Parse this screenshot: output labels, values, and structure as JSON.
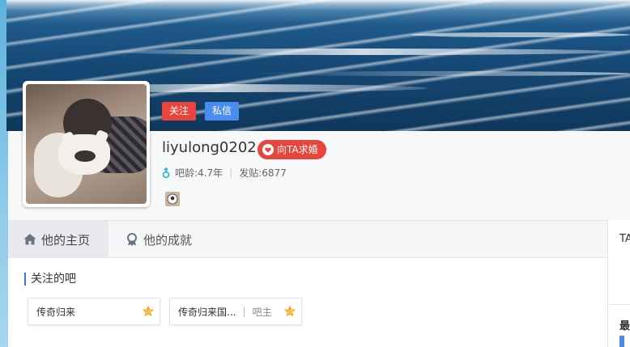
{
  "profile": {
    "username": "liyulong0202",
    "follow_label": "关注",
    "message_label": "私信",
    "propose_label": "向TA求婚",
    "bar_age_label": "吧龄:4.7年",
    "posts_label": "发贴:6877"
  },
  "tabs": [
    {
      "label": "他的主页",
      "icon": "home-icon"
    },
    {
      "label": "他的成就",
      "icon": "badge-icon"
    }
  ],
  "followed_bars": {
    "title": "关注的吧",
    "items": [
      {
        "name": "传奇归来",
        "role": ""
      },
      {
        "name": "传奇归来国...",
        "role": "吧主"
      }
    ]
  },
  "right_panel": {
    "top_text": "TA",
    "bottom_text": "最"
  },
  "colors": {
    "follow": "#e8453c",
    "message": "#4a8cf0",
    "propose": "#e8453c",
    "accent": "#3f73d8"
  }
}
